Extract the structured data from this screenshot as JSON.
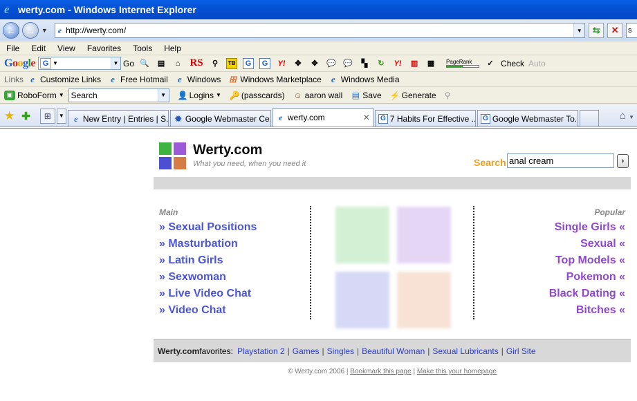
{
  "window": {
    "title": "werty.com - Windows Internet Explorer"
  },
  "nav": {
    "url": "http://werty.com/",
    "search_clip": "s"
  },
  "menu": [
    "File",
    "Edit",
    "View",
    "Favorites",
    "Tools",
    "Help"
  ],
  "google_toolbar": {
    "logo_parts": [
      "G",
      "o",
      "o",
      "g",
      "l",
      "e"
    ],
    "go_label": "Go",
    "rs_label": "RS",
    "tb_label": "TB",
    "yahoo_label": "Y!",
    "pagerank_label": "PageRank",
    "check_label": "Check",
    "auto_label": "Auto"
  },
  "links_bar": {
    "label": "Links",
    "items": [
      "Customize Links",
      "Free Hotmail",
      "Windows",
      "Windows Marketplace",
      "Windows Media"
    ]
  },
  "roboform": {
    "label": "RoboForm",
    "search_placeholder": "Search",
    "items": [
      "Logins",
      "(passcards)",
      "aaron wall",
      "Save",
      "Generate"
    ]
  },
  "tabs": [
    {
      "label": "New Entry | Entries | S...",
      "icon": "ie-icon"
    },
    {
      "label": "Google Webmaster Ce...",
      "icon": "gear-icon"
    },
    {
      "label": "werty.com",
      "icon": "ie-icon",
      "active": true
    },
    {
      "label": "7 Habits For Effective ...",
      "icon": "google-icon"
    },
    {
      "label": "Google Webmaster To...",
      "icon": "google-icon"
    }
  ],
  "site": {
    "title": "Werty.com",
    "tagline": "What you need, when you need it",
    "search_label": "Search",
    "search_value": "anal cream",
    "search_button": "›",
    "main_label": "Main",
    "popular_label": "Popular",
    "main_links": [
      "» Sexual Positions",
      "» Masturbation",
      "» Latin Girls",
      "» Sexwoman",
      "» Live Video Chat",
      "» Video Chat"
    ],
    "popular_links": [
      "Single Girls «",
      "Sexual «",
      "Top Models «",
      "Pokemon «",
      "Black Dating «",
      "Bitches «"
    ],
    "favorites_brand": "Werty.com",
    "favorites_label": " favorites:",
    "favorites": [
      "Playstation 2",
      "Games",
      "Singles",
      "Beautiful Woman",
      "Sexual Lubricants",
      "Girl Site"
    ],
    "footer_copy": "© Werty.com 2006",
    "footer_links": [
      "Bookmark this page",
      "Make this your homepage"
    ]
  },
  "colors": {
    "logo_green": "#3fb33f",
    "logo_purple": "#9c5ad8",
    "logo_blue": "#4a4fd3",
    "logo_orange": "#d67d45",
    "main_link": "#4a55d8",
    "popular_link": "#9048cc",
    "search_label": "#f0a020"
  }
}
